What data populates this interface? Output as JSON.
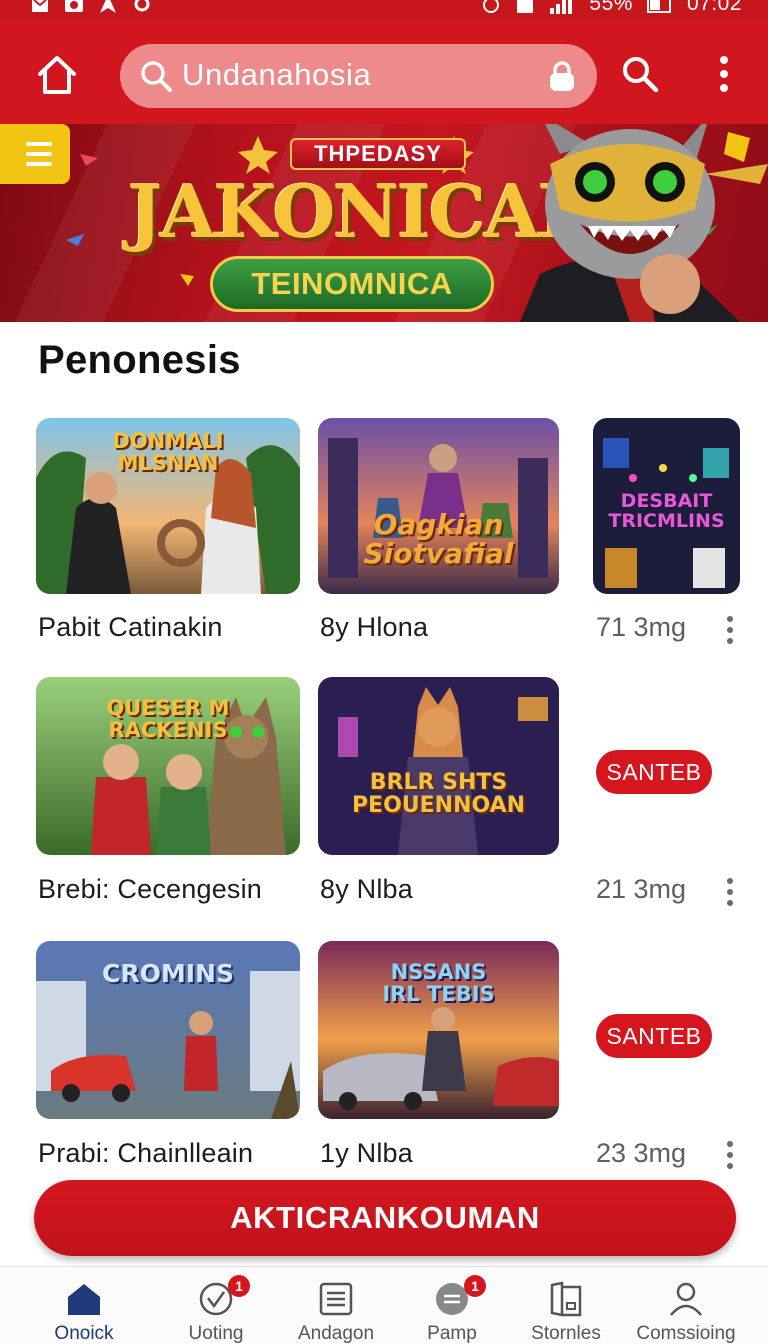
{
  "status_bar": {
    "battery": "55%",
    "time": "07:02"
  },
  "app_bar": {
    "search_text": "Undanahosia",
    "icons": [
      "home-icon",
      "search-icon",
      "lock-icon",
      "more-vertical-icon"
    ]
  },
  "banner": {
    "ribbon": "THPEDASY",
    "title": "JAKONICAL",
    "subtitle": "TEINOMNICA"
  },
  "section": {
    "title": "Penonesis"
  },
  "rows": [
    {
      "label": "Pabit Catinakin",
      "author": "8y Hlona",
      "meta": "71 3mg",
      "thumbs": [
        {
          "art": "DONMALI\nMLSNAN"
        },
        {
          "art": "Oagkian\nSiotvafial"
        },
        {
          "art": "DESBAIT\nTRICMLINS"
        }
      ]
    },
    {
      "label": "Brebi: Cecengesin",
      "author": "8y Nlba",
      "meta": "21 3mg",
      "pill": "SANTEB",
      "thumbs": [
        {
          "art": "QUESER M\nRACKENIS"
        },
        {
          "art": "BRLR SHTS\nPEOUENNOAN"
        }
      ]
    },
    {
      "label": "Prabi: Chainlleain",
      "author": "1y Nlba",
      "meta": "23 3mg",
      "pill": "SANTEB",
      "thumbs": [
        {
          "art": "CROMINS"
        },
        {
          "art": "NSSANS\nIRL TEBIS"
        }
      ]
    }
  ],
  "cta": {
    "label": "AKTICRANKOUMAN"
  },
  "bottom_nav": [
    {
      "label": "Onoick",
      "icon": "home-icon",
      "active": true
    },
    {
      "label": "Uoting",
      "icon": "voting-icon",
      "badge": "1"
    },
    {
      "label": "Andagon",
      "icon": "list-icon"
    },
    {
      "label": "Pamp",
      "icon": "chat-icon",
      "badge": "1"
    },
    {
      "label": "Stornles",
      "icon": "store-icon"
    },
    {
      "label": "Comssioing",
      "icon": "profile-icon"
    }
  ],
  "colors": {
    "brand_red": "#d2161e",
    "accent_yellow": "#f2c515",
    "nav_active": "#1f3a7a"
  }
}
